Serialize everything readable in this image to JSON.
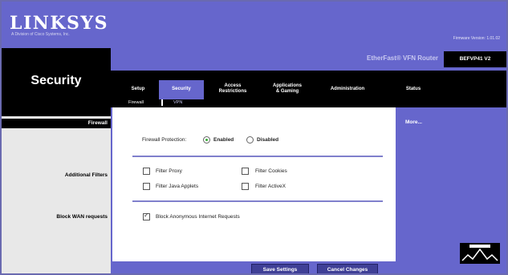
{
  "banner": {
    "logo": "LINKSYS",
    "logo_sub": "A Division of Cisco Systems, Inc.",
    "firmware": "Firmware Version: 1.01.02"
  },
  "product": {
    "name": "EtherFast® VFN Router",
    "model": "BEFVP41 V2"
  },
  "section_title": "Security",
  "tabs": [
    {
      "label": "Setup"
    },
    {
      "label": "Security"
    },
    {
      "label": "Access\nRestrictions"
    },
    {
      "label": "Applications\n& Gaming"
    },
    {
      "label": "Administration"
    },
    {
      "label": "Status"
    }
  ],
  "subtabs": [
    {
      "label": "Firewall"
    },
    {
      "label": "VPN"
    }
  ],
  "labels": {
    "firewall": "Firewall",
    "additional_filters": "Additional Filters",
    "block_wan": "Block WAN requests"
  },
  "firewall": {
    "label": "Firewall Protection:",
    "enabled": "Enabled",
    "disabled": "Disabled"
  },
  "filters": {
    "proxy": "Filter Proxy",
    "cookies": "Filter Cookies",
    "java": "Filter Java Applets",
    "activex": "Filter ActiveX"
  },
  "block": {
    "anon": "Block Anonymous Internet Requests"
  },
  "help": {
    "more": "More..."
  },
  "buttons": {
    "save": "Save Settings",
    "cancel": "Cancel Changes"
  },
  "colors": {
    "brand_purple": "#6666cc",
    "dark": "#000000"
  }
}
